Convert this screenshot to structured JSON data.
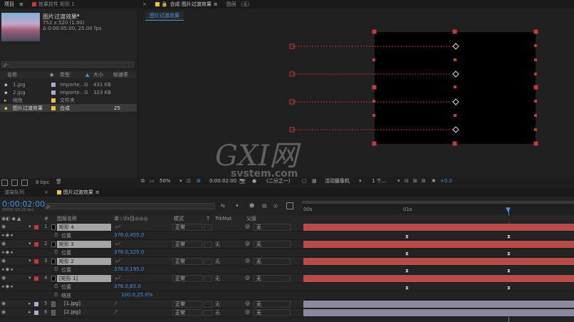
{
  "project_panel": {
    "tabs": [
      "项目",
      "效果控件 矩形 1"
    ],
    "comp_name": "图片过渡效果",
    "comp_info_size": "752 x 520 (1.00)",
    "comp_info_duration": "Δ 0:00:05:00, 25.00 fps",
    "search_placeholder": "ρ-",
    "columns": {
      "name": "名称",
      "type": "类型",
      "size": "大小",
      "fps": "帧速率"
    },
    "items": [
      {
        "name": "1.jpg",
        "type": "Importe...G",
        "size": "431 KB",
        "fps": "",
        "color": "#b6a7d6"
      },
      {
        "name": "2.jpg",
        "type": "Importe...G",
        "size": "323 KB",
        "fps": "",
        "color": "#b6a7d6"
      },
      {
        "name": "纯色",
        "type": "文件夹",
        "size": "",
        "fps": "",
        "color": "#e6c34a"
      },
      {
        "name": "图片过渡效果",
        "type": "合成",
        "size": "",
        "fps": "25",
        "color": "#e6c34a"
      }
    ],
    "bpc": "8 bpc"
  },
  "comp_panel": {
    "tabs": [
      "合成 图片过渡效果",
      "图层 （无）"
    ],
    "subtab": "图片过渡效果",
    "zoom": "50%",
    "timecode": "0:00:02:00",
    "resolution": "(二分之一)",
    "camera": "活动摄像机",
    "views": "1 个...",
    "exposure": "+0.0"
  },
  "timeline": {
    "tabs": [
      "渲染队列",
      "图片过渡效果"
    ],
    "timecode": "0:00:02:00",
    "frame_info": "00050 (25.00 fps)",
    "search_placeholder": "ρ-",
    "headers": {
      "source": "图层名称",
      "switches": "单☆\\fx目◎◎◎",
      "mode": "模式",
      "t": "T",
      "trkmat": "TrkMat",
      "parent": "父级"
    },
    "ruler": {
      "start": "00s",
      "one": "01s"
    },
    "layers": [
      {
        "num": "1",
        "name": "矩形 4",
        "mode": "正常",
        "trk": "",
        "parent": "无",
        "label": "#c23a3a",
        "prop": "位置",
        "value": "376.0,455.0",
        "barColor": "#b84a4a"
      },
      {
        "num": "2",
        "name": "矩形 3",
        "mode": "正常",
        "trk": "无",
        "parent": "无",
        "label": "#c23a3a",
        "prop": "位置",
        "value": "376.0,325.0",
        "barColor": "#b84a4a"
      },
      {
        "num": "3",
        "name": "矩形 2",
        "mode": "正常",
        "trk": "无",
        "parent": "无",
        "label": "#c23a3a",
        "prop": "位置",
        "value": "376.0,195.0",
        "barColor": "#b84a4a"
      },
      {
        "num": "4",
        "name": "[矩形 1]",
        "mode": "正常",
        "trk": "无",
        "parent": "无",
        "label": "#c23a3a",
        "prop": "位置",
        "value": "376.0,65.0",
        "barColor": "#b84a4a"
      }
    ],
    "scale_prop": "缩放",
    "scale_value": "100.0,25.0%",
    "image_layers": [
      {
        "num": "5",
        "name": "[1.jpg]",
        "mode": "正常",
        "trk": "无",
        "parent": "无",
        "label": "#b6a7d6"
      },
      {
        "num": "6",
        "name": "[2.jpg]",
        "mode": "正常",
        "trk": "无",
        "parent": "无",
        "label": "#b6a7d6"
      }
    ]
  },
  "watermark": {
    "text": "GXI网",
    "sub": "system.com"
  }
}
